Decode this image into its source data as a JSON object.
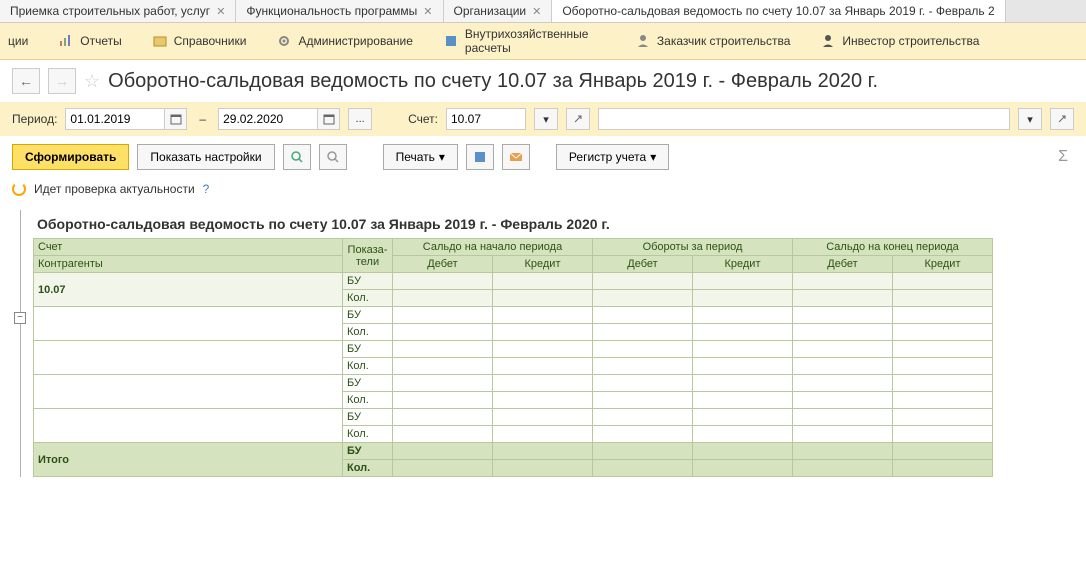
{
  "tabs": [
    {
      "label": "Приемка строительных работ, услуг"
    },
    {
      "label": "Функциональность программы"
    },
    {
      "label": "Организации"
    },
    {
      "label": "Оборотно-сальдовая ведомость по счету 10.07 за Январь 2019 г. - Февраль 2"
    }
  ],
  "toolbar": [
    {
      "label": "ции"
    },
    {
      "label": "Отчеты"
    },
    {
      "label": "Справочники"
    },
    {
      "label": "Администрирование"
    },
    {
      "label": "Внутрихозяйственные расчеты"
    },
    {
      "label": "Заказчик строительства"
    },
    {
      "label": "Инвестор строительства"
    }
  ],
  "page_title": "Оборотно-сальдовая ведомость по счету 10.07 за Январь 2019 г. - Февраль 2020 г.",
  "period": {
    "label": "Период:",
    "from": "01.01.2019",
    "to": "29.02.2020",
    "account_label": "Счет:",
    "account": "10.07"
  },
  "actions": {
    "generate": "Сформировать",
    "show_settings": "Показать настройки",
    "print": "Печать",
    "register": "Регистр учета"
  },
  "status": {
    "text": "Идет проверка актуальности",
    "help": "?"
  },
  "report": {
    "title": "Оборотно-сальдовая ведомость по счету 10.07 за Январь 2019 г. - Февраль 2020 г.",
    "headers": {
      "account": "Счет",
      "counterparties": "Контрагенты",
      "indicators": "Показа-\nтели",
      "opening": "Сальдо на начало периода",
      "turnover": "Обороты за период",
      "closing": "Сальдо на конец периода",
      "debit": "Дебет",
      "credit": "Кредит"
    },
    "account_value": "10.07",
    "indicator_bu": "БУ",
    "indicator_kol": "Кол.",
    "total": "Итого"
  }
}
